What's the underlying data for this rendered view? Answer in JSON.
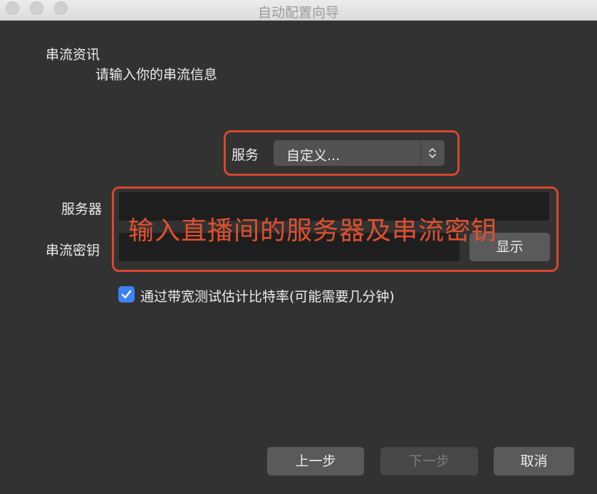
{
  "window": {
    "title": "自动配置向导"
  },
  "section": {
    "title": "串流资讯",
    "subtitle": "请输入你的串流信息"
  },
  "service": {
    "label": "服务",
    "selected": "自定义..."
  },
  "server": {
    "label": "服务器",
    "value": ""
  },
  "stream_key": {
    "label": "串流密钥",
    "value": "",
    "show_label": "显示"
  },
  "annotation": {
    "text": "输入直播间的服务器及串流密钥",
    "color": "#e0502f"
  },
  "bandwidth_test": {
    "label": "通过带宽测试估计比特率(可能需要几分钟)",
    "checked": true
  },
  "buttons": {
    "back": "上一步",
    "next": "下一步",
    "cancel": "取消"
  },
  "colors": {
    "highlight": "#d8482a",
    "accent": "#3b82f6",
    "background": "#323232"
  },
  "icons": {
    "window_controls": [
      "close-icon",
      "minimize-icon",
      "zoom-icon"
    ],
    "select": "chevron-updown-icon",
    "checkbox": "check-icon"
  }
}
